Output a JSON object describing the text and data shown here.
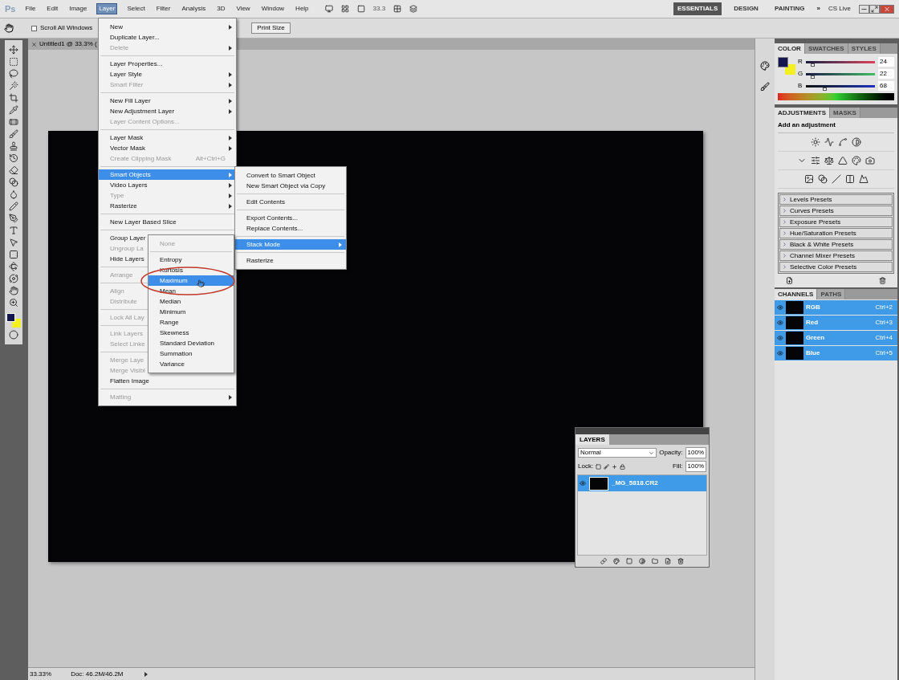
{
  "menu_bar": {
    "logo": "Ps",
    "menus": [
      {
        "label": "File",
        "selected": false
      },
      {
        "label": "Edit",
        "selected": false
      },
      {
        "label": "Image",
        "selected": false
      },
      {
        "label": "Layer",
        "selected": true
      },
      {
        "label": "Select",
        "selected": false
      },
      {
        "label": "Filter",
        "selected": false
      },
      {
        "label": "Analysis",
        "selected": false
      },
      {
        "label": "3D",
        "selected": false
      },
      {
        "label": "View",
        "selected": false
      },
      {
        "label": "Window",
        "selected": false
      },
      {
        "label": "Help",
        "selected": false
      }
    ],
    "zoom": "33.3",
    "workspaces": [
      {
        "label": "ESSENTIALS",
        "selected": true
      },
      {
        "label": "DESIGN",
        "selected": false
      },
      {
        "label": "PAINTING",
        "selected": false
      }
    ],
    "more": "»",
    "cs_live": "CS Live"
  },
  "options_bar": {
    "checkbox": {
      "label": "Scroll All Windows",
      "checked": false
    },
    "button": "Print Size"
  },
  "document": {
    "tab": "Untitled1 @ 33.3% ("
  },
  "status_bar": {
    "zoom": "33.33%",
    "doc": "Doc: 46.2M/46.2M"
  },
  "layer_menu": [
    {
      "kind": "item",
      "label": "New",
      "disabled": false,
      "submenu": true,
      "selected": false
    },
    {
      "kind": "item",
      "label": "Duplicate Layer...",
      "disabled": false,
      "submenu": false,
      "selected": false
    },
    {
      "kind": "item",
      "label": "Delete",
      "disabled": true,
      "submenu": true,
      "selected": false
    },
    {
      "kind": "separator"
    },
    {
      "kind": "item",
      "label": "Layer Properties...",
      "disabled": false,
      "submenu": false,
      "selected": false
    },
    {
      "kind": "item",
      "label": "Layer Style",
      "disabled": false,
      "submenu": true,
      "selected": false
    },
    {
      "kind": "item",
      "label": "Smart Filter",
      "disabled": true,
      "submenu": true,
      "selected": false
    },
    {
      "kind": "separator"
    },
    {
      "kind": "item",
      "label": "New Fill Layer",
      "disabled": false,
      "submenu": true,
      "selected": false
    },
    {
      "kind": "item",
      "label": "New Adjustment Layer",
      "disabled": false,
      "submenu": true,
      "selected": false
    },
    {
      "kind": "item",
      "label": "Layer Content Options...",
      "disabled": true,
      "submenu": false,
      "selected": false
    },
    {
      "kind": "separator"
    },
    {
      "kind": "item",
      "label": "Layer Mask",
      "disabled": false,
      "submenu": true,
      "selected": false
    },
    {
      "kind": "item",
      "label": "Vector Mask",
      "disabled": false,
      "submenu": true,
      "selected": false
    },
    {
      "kind": "item",
      "label": "Create Clipping Mask",
      "shortcut": "Alt+Ctrl+G",
      "disabled": true,
      "submenu": false,
      "selected": false
    },
    {
      "kind": "separator"
    },
    {
      "kind": "item",
      "label": "Smart Objects",
      "disabled": false,
      "submenu": true,
      "selected": true
    },
    {
      "kind": "item",
      "label": "Video Layers",
      "disabled": false,
      "submenu": true,
      "selected": false
    },
    {
      "kind": "item",
      "label": "Type",
      "disabled": true,
      "submenu": true,
      "selected": false
    },
    {
      "kind": "item",
      "label": "Rasterize",
      "disabled": false,
      "submenu": true,
      "selected": false
    },
    {
      "kind": "separator"
    },
    {
      "kind": "item",
      "label": "New Layer Based Slice",
      "disabled": false,
      "submenu": false,
      "selected": false
    },
    {
      "kind": "separator"
    },
    {
      "kind": "item",
      "label": "Group Layer",
      "disabled": false,
      "submenu": false,
      "selected": false
    },
    {
      "kind": "item",
      "label": "Ungroup La",
      "disabled": true,
      "submenu": false,
      "selected": false
    },
    {
      "kind": "item",
      "label": "Hide Layers",
      "disabled": false,
      "submenu": false,
      "selected": false
    },
    {
      "kind": "separator"
    },
    {
      "kind": "item",
      "label": "Arrange",
      "disabled": true,
      "submenu": false,
      "selected": false
    },
    {
      "kind": "separator"
    },
    {
      "kind": "item",
      "label": "Align",
      "disabled": true,
      "submenu": false,
      "selected": false
    },
    {
      "kind": "item",
      "label": "Distribute",
      "disabled": true,
      "submenu": false,
      "selected": false
    },
    {
      "kind": "separator"
    },
    {
      "kind": "item",
      "label": "Lock All Lay",
      "disabled": true,
      "submenu": false,
      "selected": false
    },
    {
      "kind": "separator"
    },
    {
      "kind": "item",
      "label": "Link Layers",
      "disabled": true,
      "submenu": false,
      "selected": false
    },
    {
      "kind": "item",
      "label": "Select Linke",
      "disabled": true,
      "submenu": false,
      "selected": false
    },
    {
      "kind": "separator"
    },
    {
      "kind": "item",
      "label": "Merge Laye",
      "disabled": true,
      "submenu": false,
      "selected": false
    },
    {
      "kind": "item",
      "label": "Merge Visibl",
      "disabled": true,
      "submenu": false,
      "selected": false
    },
    {
      "kind": "item",
      "label": "Flatten Image",
      "disabled": false,
      "submenu": false,
      "selected": false
    },
    {
      "kind": "separator"
    },
    {
      "kind": "item",
      "label": "Matting",
      "disabled": true,
      "submenu": true,
      "selected": false
    }
  ],
  "smart_objects_menu": [
    {
      "kind": "item",
      "label": "Convert to Smart Object",
      "disabled": false,
      "submenu": false,
      "selected": false
    },
    {
      "kind": "item",
      "label": "New Smart Object via Copy",
      "disabled": false,
      "submenu": false,
      "selected": false
    },
    {
      "kind": "separator"
    },
    {
      "kind": "item",
      "label": "Edit Contents",
      "disabled": false,
      "submenu": false,
      "selected": false
    },
    {
      "kind": "separator"
    },
    {
      "kind": "item",
      "label": "Export Contents...",
      "disabled": false,
      "submenu": false,
      "selected": false
    },
    {
      "kind": "item",
      "label": "Replace Contents...",
      "disabled": false,
      "submenu": false,
      "selected": false
    },
    {
      "kind": "separator"
    },
    {
      "kind": "item",
      "label": "Stack Mode",
      "disabled": false,
      "submenu": true,
      "selected": true
    },
    {
      "kind": "separator"
    },
    {
      "kind": "item",
      "label": "Rasterize",
      "disabled": false,
      "submenu": false,
      "selected": false
    }
  ],
  "stack_mode_menu": [
    {
      "kind": "item",
      "label": "None",
      "disabled": true,
      "submenu": false,
      "selected": false
    },
    {
      "kind": "separator"
    },
    {
      "kind": "item",
      "label": "Entropy",
      "disabled": false,
      "submenu": false,
      "selected": false
    },
    {
      "kind": "item",
      "label": "Kurtosis",
      "disabled": false,
      "submenu": false,
      "selected": false
    },
    {
      "kind": "item",
      "label": "Maximum",
      "disabled": false,
      "submenu": false,
      "selected": true
    },
    {
      "kind": "item",
      "label": "Mean",
      "disabled": false,
      "submenu": false,
      "selected": false
    },
    {
      "kind": "item",
      "label": "Median",
      "disabled": false,
      "submenu": false,
      "selected": false
    },
    {
      "kind": "item",
      "label": "Minimum",
      "disabled": false,
      "submenu": false,
      "selected": false
    },
    {
      "kind": "item",
      "label": "Range",
      "disabled": false,
      "submenu": false,
      "selected": false
    },
    {
      "kind": "item",
      "label": "Skewness",
      "disabled": false,
      "submenu": false,
      "selected": false
    },
    {
      "kind": "item",
      "label": "Standard Deviation",
      "disabled": false,
      "submenu": false,
      "selected": false
    },
    {
      "kind": "item",
      "label": "Summation",
      "disabled": false,
      "submenu": false,
      "selected": false
    },
    {
      "kind": "item",
      "label": "Variance",
      "disabled": false,
      "submenu": false,
      "selected": false
    }
  ],
  "color_panel": {
    "tabs": [
      {
        "label": "COLOR",
        "selected": true
      },
      {
        "label": "SWATCHES",
        "selected": false
      },
      {
        "label": "STYLES",
        "selected": false
      }
    ],
    "channels": [
      {
        "name": "R",
        "level": 0.09,
        "reading": "24"
      },
      {
        "name": "G",
        "level": 0.09,
        "reading": "22"
      },
      {
        "name": "B",
        "level": 0.27,
        "reading": "68"
      }
    ]
  },
  "adjustments_panel": {
    "tabs": [
      {
        "label": "ADJUSTMENTS",
        "selected": true
      },
      {
        "label": "MASKS",
        "selected": false
      }
    ],
    "heading": "Add an adjustment",
    "presets": [
      "Levels Presets",
      "Curves Presets",
      "Exposure Presets",
      "Hue/Saturation Presets",
      "Black & White Presets",
      "Channel Mixer Presets",
      "Selective Color Presets"
    ]
  },
  "channels_panel": {
    "tabs": [
      {
        "label": "CHANNELS",
        "selected": true
      },
      {
        "label": "PATHS",
        "selected": false
      }
    ],
    "rows": [
      {
        "name": "RGB",
        "shortcut": "Ctrl+2",
        "selected": true,
        "visible": true
      },
      {
        "name": "Red",
        "shortcut": "Ctrl+3",
        "selected": true,
        "visible": true
      },
      {
        "name": "Green",
        "shortcut": "Ctrl+4",
        "selected": true,
        "visible": true
      },
      {
        "name": "Blue",
        "shortcut": "Ctrl+5",
        "selected": true,
        "visible": true
      }
    ]
  },
  "layers_panel": {
    "tab": "LAYERS",
    "blend_mode": "Normal",
    "opacity_label": "Opacity:",
    "opacity": "100%",
    "lock_label": "Lock:",
    "fill_label": "Fill:",
    "fill": "100%",
    "layers": [
      {
        "name": "_MG_5818.CR2",
        "selected": true,
        "visible": true
      }
    ]
  }
}
